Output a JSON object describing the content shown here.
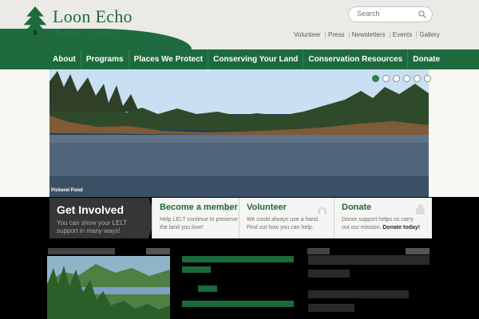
{
  "brand": {
    "name": "Loon Echo",
    "tagline": "Land Trust"
  },
  "search": {
    "placeholder": "Search"
  },
  "utility_links": [
    "Volunteer",
    "Press",
    "Newsletters",
    "Events",
    "Gallery"
  ],
  "nav": [
    "About",
    "Programs",
    "Places We Protect",
    "Conserving Your Land",
    "Conservation Resources",
    "Donate"
  ],
  "hero": {
    "caption": "Pickerel Pond"
  },
  "cards": {
    "main_title": "Get Involved",
    "main_text": "You can show your LELT support in many ways!",
    "member_title": "Become a member",
    "member_text": "Help LELT continue to preserve the land you love!",
    "volunteer_title": "Volunteer",
    "volunteer_text": "We could always use a hand. Find out how you can help.",
    "donate_title": "Donate",
    "donate_text": "Donor support helps us carry out our mission.",
    "donate_cta": "Donate today!"
  },
  "colors": {
    "brand_green": "#1d6a3c",
    "link_green": "#23a455"
  }
}
